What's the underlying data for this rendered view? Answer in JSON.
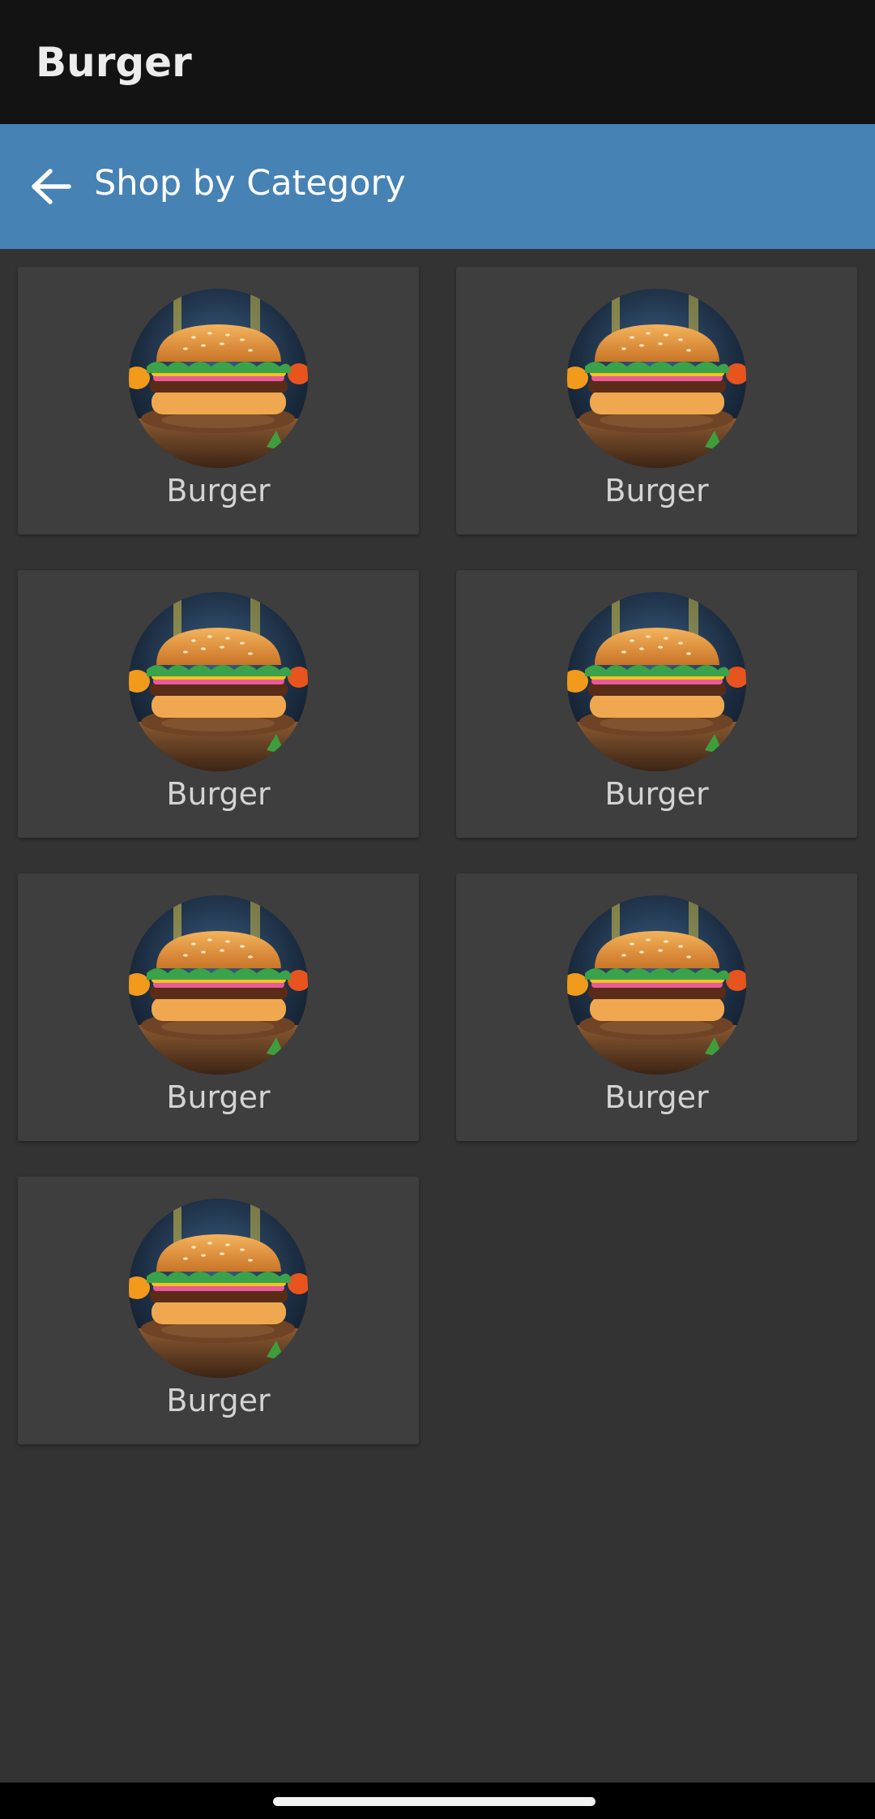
{
  "app": {
    "title": "Burger"
  },
  "toolbar": {
    "title": "Shop by Category",
    "back_icon": "arrow-left-icon"
  },
  "categories": [
    {
      "label": "Burger"
    },
    {
      "label": "Burger"
    },
    {
      "label": "Burger"
    },
    {
      "label": "Burger"
    },
    {
      "label": "Burger"
    },
    {
      "label": "Burger"
    },
    {
      "label": "Burger"
    }
  ],
  "colors": {
    "title_bar": "#131313",
    "toolbar": "#4682b4",
    "background": "#333333",
    "card": "#3e3e3e"
  }
}
